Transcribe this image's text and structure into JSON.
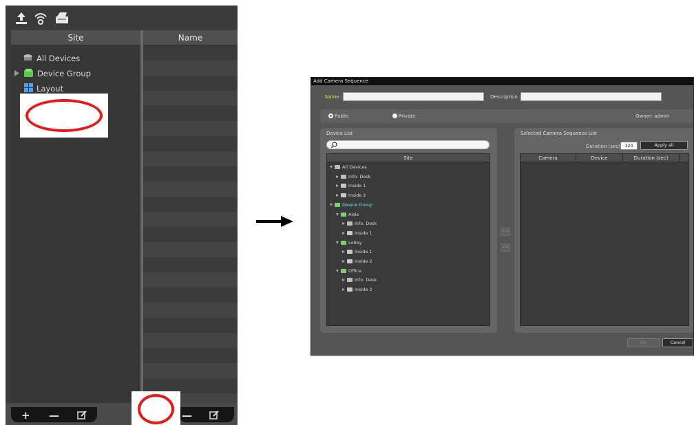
{
  "left_panel": {
    "toolbar_icons": [
      "upload-icon",
      "wifi-icon",
      "folder-icon"
    ],
    "columns": {
      "site": "Site",
      "name": "Name"
    },
    "tree": [
      {
        "label": "All Devices",
        "icon": "devices-icon"
      },
      {
        "label": "Device Group",
        "icon": "device-group-icon"
      },
      {
        "label": "Layout",
        "icon": "layout-icon"
      }
    ],
    "footer_icons": [
      "add-icon",
      "remove-icon",
      "edit-icon",
      "remove-icon",
      "edit-icon"
    ],
    "highlight_color": "#e41b1b"
  },
  "dialog": {
    "title": "Add Camera Sequence",
    "name_label": "Name :",
    "name_value": "",
    "description_label": "Description :",
    "description_value": "",
    "radio_public": "Public",
    "radio_private": "Private",
    "selected_visibility": "Public",
    "owner_label": "Owner: admin",
    "device_list": {
      "title": "Device List",
      "search_placeholder": "",
      "column": "Site",
      "tree": [
        {
          "label": "All Devices",
          "level": 0,
          "expanded": true,
          "icon": "devices-icon"
        },
        {
          "label": "Info. Desk",
          "level": 1,
          "expanded": false,
          "icon": "camera-icon"
        },
        {
          "label": "Inside 1",
          "level": 1,
          "expanded": false,
          "icon": "dome-camera-icon"
        },
        {
          "label": "Inside 2",
          "level": 1,
          "expanded": false,
          "icon": "recorder-icon"
        },
        {
          "label": "Device Group",
          "level": 0,
          "expanded": true,
          "icon": "device-group-icon",
          "highlighted": true
        },
        {
          "label": "Aisle",
          "level": 1,
          "expanded": true,
          "icon": "device-group-icon"
        },
        {
          "label": "Info. Desk",
          "level": 2,
          "expanded": false,
          "icon": "camera-icon"
        },
        {
          "label": "Inside 1",
          "level": 2,
          "expanded": false,
          "icon": "dome-camera-icon"
        },
        {
          "label": "Lobby",
          "level": 1,
          "expanded": true,
          "icon": "device-group-icon"
        },
        {
          "label": "Inside 1",
          "level": 2,
          "expanded": false,
          "icon": "dome-camera-icon"
        },
        {
          "label": "Inside 2",
          "level": 2,
          "expanded": false,
          "icon": "recorder-icon"
        },
        {
          "label": "Office",
          "level": 1,
          "expanded": true,
          "icon": "device-group-icon"
        },
        {
          "label": "Info. Desk",
          "level": 2,
          "expanded": false,
          "icon": "camera-icon"
        },
        {
          "label": "Inside 2",
          "level": 2,
          "expanded": false,
          "icon": "recorder-icon"
        }
      ]
    },
    "transfer_add": ">>",
    "transfer_remove": "<<",
    "sequence_list": {
      "title": "Selected Camera Sequence List",
      "duration_label": "Duration (sec) :",
      "duration_value": "120",
      "apply_all": "Apply all",
      "columns": [
        "Camera",
        "Device",
        "Duration (sec)"
      ]
    },
    "ok": "OK",
    "cancel": "Cancel"
  }
}
